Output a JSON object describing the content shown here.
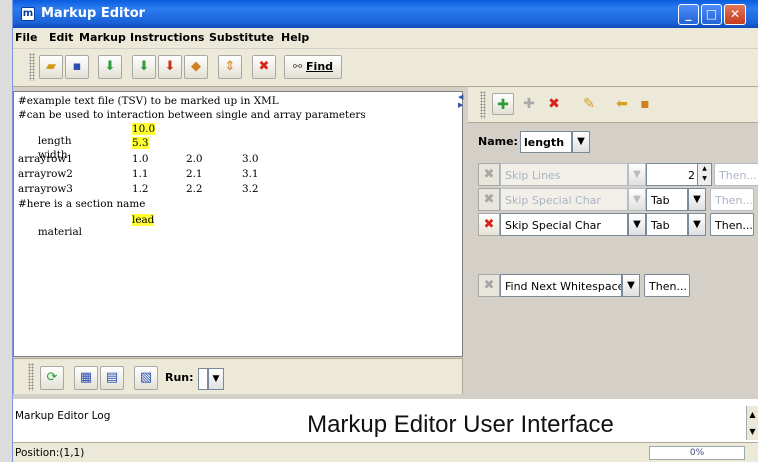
{
  "window": {
    "title": "Markup Editor"
  },
  "menu": [
    "File",
    "Edit",
    "Markup",
    "Instructions",
    "Substitute",
    "Help"
  ],
  "toolbar": {
    "find_label": "Find"
  },
  "editor": {
    "lines": [
      "#example text file (TSV) to be marked up in XML",
      "#can be used to interaction between single and array parameters",
      "length",
      "width",
      "arrayrow1",
      "arrayrow2",
      "arrayrow3",
      "#here is a section name",
      "material"
    ],
    "values": {
      "length": "10.0",
      "width": "5.3",
      "material": "lead",
      "arrayrow1": [
        "1.0",
        "2.0",
        "3.0"
      ],
      "arrayrow2": [
        "1.1",
        "2.1",
        "3.1"
      ],
      "arrayrow3": [
        "1.2",
        "2.2",
        "3.2"
      ]
    },
    "highlight_color": "#ffff33"
  },
  "editor_bar": {
    "run_label": "Run:",
    "run_value": ""
  },
  "rules": {
    "name_label": "Name:",
    "name_value": "length",
    "rows": [
      {
        "action": "Skip Lines",
        "count": "2",
        "then": "Then...",
        "enabled": false
      },
      {
        "action": "Skip Special Char",
        "char": "Tab",
        "then": "Then...",
        "enabled": false
      },
      {
        "action": "Skip Special Char",
        "char": "Tab",
        "then": "Then...",
        "enabled": true
      },
      {
        "action": "Find Next Whitespace",
        "then": "Then...",
        "enabled": false
      }
    ]
  },
  "log": {
    "label": "Markup Editor Log",
    "caption": "Markup Editor User Interface"
  },
  "status": {
    "position": "Position:(1,1)",
    "progress_text": "0%",
    "progress_value": 0
  }
}
